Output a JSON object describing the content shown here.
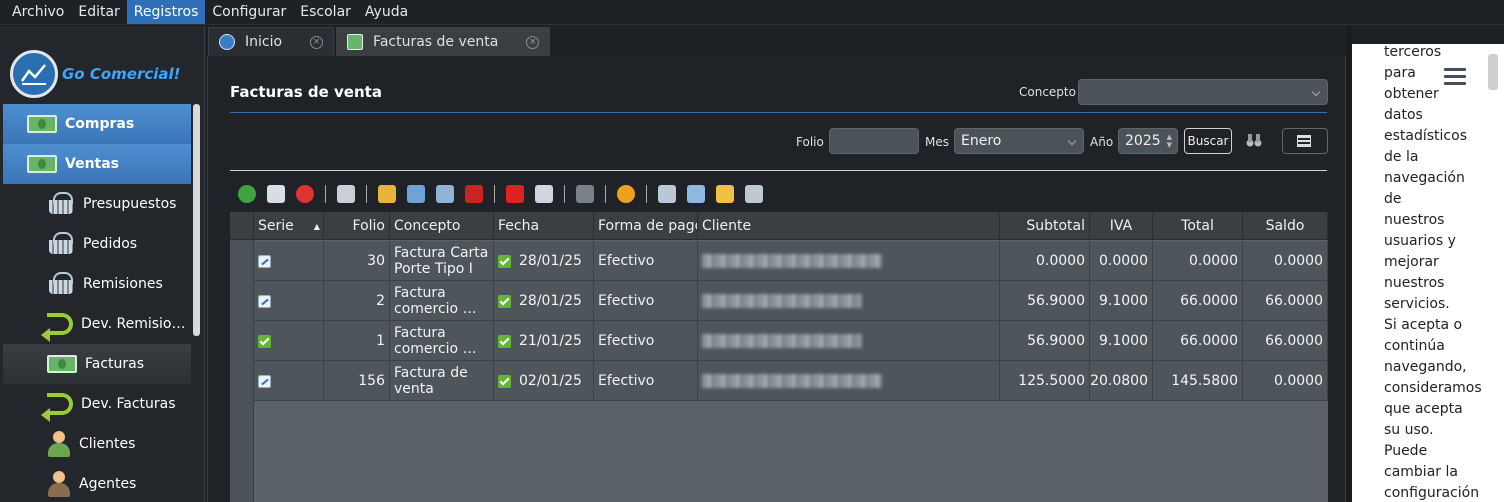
{
  "menu": [
    "Archivo",
    "Editar",
    "Registros",
    "Configurar",
    "Escolar",
    "Ayuda"
  ],
  "logo": {
    "text": "Go Comercial!"
  },
  "sidebar": {
    "items": [
      {
        "label": "Compras",
        "type": "group",
        "icon": "money-icon"
      },
      {
        "label": "Ventas",
        "type": "group",
        "icon": "money-add-icon"
      },
      {
        "label": "Presupuestos",
        "type": "sub",
        "icon": "basket-icon"
      },
      {
        "label": "Pedidos",
        "type": "sub",
        "icon": "basket-up-icon"
      },
      {
        "label": "Remisiones",
        "type": "sub",
        "icon": "basket-arrow-icon"
      },
      {
        "label": "Dev. Remisio…",
        "type": "sub",
        "icon": "return-icon"
      },
      {
        "label": "Facturas",
        "type": "sub",
        "icon": "money-add-icon"
      },
      {
        "label": "Dev. Facturas",
        "type": "sub",
        "icon": "return-icon"
      },
      {
        "label": "Clientes",
        "type": "sub",
        "icon": "person-icon"
      },
      {
        "label": "Agentes",
        "type": "sub",
        "icon": "agent-icon"
      }
    ]
  },
  "tabs": [
    {
      "label": "Inicio",
      "icon": "home-icon"
    },
    {
      "label": "Facturas de venta",
      "icon": "invoice-icon"
    }
  ],
  "panel": {
    "title": "Facturas de venta",
    "concepto_label": "Concepto",
    "concepto_value": "",
    "folio_label": "Folio",
    "folio_value": "",
    "mes_label": "Mes",
    "mes_value": "Enero",
    "anio_label": "Año",
    "anio_value": "2025",
    "buscar_label": "Buscar"
  },
  "toolbar_icons": [
    "add-icon",
    "edit-icon",
    "delete-icon",
    "print-icon",
    "clean-icon",
    "email-icon",
    "archive-icon",
    "cancel-icon",
    "pdf-icon",
    "list-icon",
    "tree-icon",
    "asterisk-icon",
    "export-icon",
    "columns-icon",
    "copy-icon",
    "printer-add-icon"
  ],
  "table": {
    "columns": [
      "Serie",
      "Folio",
      "Concepto",
      "Fecha",
      "Forma de pago",
      "Cliente",
      "Subtotal",
      "IVA",
      "Total",
      "Saldo"
    ],
    "rows": [
      {
        "serie_chk": "pending",
        "folio": "30",
        "concepto1": "Factura Carta",
        "concepto2": "Porte Tipo I",
        "fecha": "28/01/25",
        "forma": "Efectivo",
        "subtotal": "0.0000",
        "iva": "0.0000",
        "total": "0.0000",
        "saldo": "0.0000"
      },
      {
        "serie_chk": "pending",
        "folio": "2",
        "concepto1": "Factura",
        "concepto2": "comercio …",
        "fecha": "28/01/25",
        "forma": "Efectivo",
        "subtotal": "56.9000",
        "iva": "9.1000",
        "total": "66.0000",
        "saldo": "66.0000"
      },
      {
        "serie_chk": "done",
        "folio": "1",
        "concepto1": "Factura",
        "concepto2": "comercio …",
        "fecha": "21/01/25",
        "forma": "Efectivo",
        "subtotal": "56.9000",
        "iva": "9.1000",
        "total": "66.0000",
        "saldo": "66.0000"
      },
      {
        "serie_chk": "pending",
        "folio": "156",
        "concepto1": "Factura de",
        "concepto2": "venta",
        "fecha": "02/01/25",
        "forma": "Efectivo",
        "subtotal": "125.5000",
        "iva": "20.0800",
        "total": "145.5800",
        "saldo": "0.0000"
      }
    ]
  },
  "cookie": {
    "lines": [
      "terceros",
      "para",
      "obtener",
      "datos",
      "estadísticos",
      "de la",
      "navegación",
      "de",
      "nuestros",
      "usuarios y",
      "mejorar",
      "nuestros",
      "servicios.",
      "Si acepta o",
      "continúa",
      "navegando,",
      "consideramos",
      "que acepta",
      "su uso.",
      "Puede",
      "cambiar la",
      "configuración"
    ]
  }
}
